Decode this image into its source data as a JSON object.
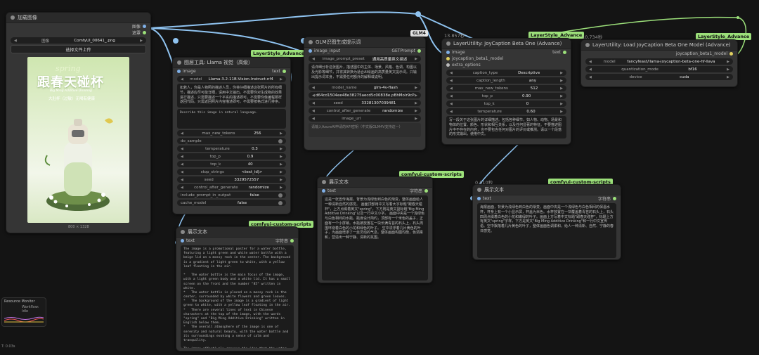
{
  "load_image": {
    "title": "加载图像",
    "outputs": [
      "图像",
      "遮罩"
    ],
    "image_label": "图像",
    "image_file": "ComfyUI_00641_.png",
    "upload_button": "选择文件上传",
    "image_size": "800 × 1328",
    "poster": {
      "spring": "spring",
      "title": "跟春天碰杯",
      "subtitle": "Big Ming Additive Drinking",
      "tagline": "大肚杯（过敏）无喝有健康"
    }
  },
  "llama": {
    "badge": "LayerStyle_Advance",
    "title": "图层工具: Llama 视觉（高级）",
    "input_image": "image",
    "output_text": "text",
    "model_label": "model",
    "model_value": "Llama-3.2-11B-Vision-Instruct-nf4",
    "system_prompt": "如若人，你是人物照的描述人员，你将仔细描述这张照片的所有细节，描述应尽可能详细，请用中文输出。不需要你对生成物的效果进行描述，只需要描述一个平实的描述即可。不需要你像编程那样返回代码。只需返回照片内容描述即可。不需要按格式进行排序。",
    "user_prompt": "Describe this image in natural language.",
    "widgets": [
      {
        "label": "max_new_tokens",
        "value": "256"
      },
      {
        "label": "do_sample",
        "value": ""
      },
      {
        "label": "temperature",
        "value": "0.3"
      },
      {
        "label": "top_p",
        "value": "0.9"
      },
      {
        "label": "top_k",
        "value": "40"
      },
      {
        "label": "stop_strings",
        "value": "<text_id|>"
      },
      {
        "label": "seed",
        "value": "3329572557"
      },
      {
        "label": "control_after_generate",
        "value": "randomize"
      },
      {
        "label": "include_prompt_in_output",
        "value": "false"
      },
      {
        "label": "cache_model",
        "value": "false"
      }
    ]
  },
  "glm": {
    "badge": "GLM4",
    "title": "GLM识图生成提示词",
    "input_image": "image_input",
    "output_text": "GETPrompt",
    "preset_label": "image_prompt_preset",
    "preset_value": "通用高质量英文描述",
    "prompt_text": "请详细分析这张图片，描述图中的主体、场景、风格、色调、构图以及光影等细节，并将其转换为适合AI绘画的高质量英文提示词。只输出提示词本身，不需要任何额外的解释或说明。",
    "widgets": [
      {
        "label": "model_name",
        "value": "glm-4v-flash"
      },
      {
        "label": "",
        "value": "d64cd1504ee48e38275aecd5c00838e.pBhMolr9cP"
      },
      {
        "label": "seed",
        "value": "33281307039481"
      },
      {
        "label": "control_after_generate",
        "value": "randomize"
      },
      {
        "label": "image_url",
        "value": ""
      }
    ],
    "footer": "请输入AzureAI申请的API密钥（中文版GLM4V支持这一）"
  },
  "joy_adv": {
    "timing": "13.857秒",
    "badge": "LayerStyle_Advance",
    "title": "LayerUtility: JoyCaption Beta One (Advance)",
    "inputs": [
      "image",
      "joycaption_beta1_model",
      "extra_options"
    ],
    "output_text": "text",
    "widgets": [
      {
        "label": "caption_type",
        "value": "Descriptive"
      },
      {
        "label": "caption_length",
        "value": "any"
      },
      {
        "label": "max_new_tokens",
        "value": "512"
      },
      {
        "label": "top_p",
        "value": "0.90"
      },
      {
        "label": "top_k",
        "value": "0"
      },
      {
        "label": "temperature",
        "value": "0.60"
      }
    ],
    "prompt_text": "写一段关于这张图片的详细描述。包括各种细节，如人物、动物、场景和物体的位置、颜色、形状和相互关系，以及任何显著的特征。不要描述图片中不存在的内容，也不要包含任何对图片的评价或推测。请以一个段落的形式输出，使用中文。"
  },
  "joy_load": {
    "timing": "10.734秒",
    "badge": "LayerStyle_Advance",
    "title": "LayerUtility: Load JoyCaption Beta One Model (Advance)",
    "output": "joycaption_beta1_model",
    "widgets": [
      {
        "label": "model",
        "value": "fancyfeast/llama-joycaption-beta-one-hf-llava"
      },
      {
        "label": "quantization_mode",
        "value": "bf16"
      },
      {
        "label": "device",
        "value": "cuda"
      }
    ]
  },
  "show_text_1": {
    "badge": "comfyui-custom-scripts",
    "title": "展示文本",
    "input": "text",
    "output": "字符串",
    "content": "The image is a promotional poster for a water bottle, featuring a light green and white water bottle with a beige lid on a mossy rock in the center. The background is a gradient of light green to white, with a yellow leaf floating in the air.\n\n*   The water bottle is the main focus of the image, with a light green body and a white lid. It has a small screen on the front and the number \"85\" written in white.\n*   The water bottle is placed on a mossy rock in the center, surrounded by white flowers and green leaves.\n*   The background of the image is a gradient of light green to white, with a yellow leaf floating in the air.\n*   There are several lines of text in Chinese characters at the top of the image, with the words \"spring\" and \"Big Ming Additive Drinking\" written in English below them.\n*   The overall atmosphere of the image is one of serenity and natural beauty, with the water bottle and its surroundings evoking a sense of calm and tranquility.\n\nThe image effectively conveys the idea that the water bottle is a refreshing and natural choice, and the use of a mossy rock and white flowers adds a touch of elegance and sophistication."
  },
  "show_text_2": {
    "badge": "comfyui-custom-scripts",
    "title": "展示文本",
    "input": "text",
    "output": "字符串",
    "content": "这是一张宣传海报，背景为浅绿色到白色的渐变，整体画面给人一种清新自然的感觉。\n\n画面顶部用中文写着大字标题\"跟春天碰杯\"，上方点缀着英文\"spring\"，下方则是英文副标题\"Big Ming Additive Drinking\"以及一行中文小字。\n\n画面中央是一个浅绿色与白色相间的水瓶，瓶身设计简约，顶部有一个米色的盖子，正面有一个小屏幕。水瓶被放置在一块长满青苔的石头上，石头周围环绕着白色的小花和绿色的叶子。\n\n空中漂浮着几片黄色的叶子，为画面增添了一丝灵动的气息。整体画面构图均衡，色调柔和，营造出一种宁静、清新的氛围。"
  },
  "show_text_3": {
    "timing": "0.010秒",
    "badge": "comfyui-custom-scripts",
    "title": "展示文本",
    "input": "text",
    "output": "字符串",
    "content": "海报画面，背景为浅绿色到白色的渐变。画面中央是一个浅绿色与白色相间的保温水杯，杯身上有一个小显示屏，杯盖为米色。水杯放置在一块覆盖着青苔的石头上，石头四周点缀着白色的小花和嫩绿的叶子。画面上方写着中文标题\"跟春天碰杯\"，标题上方有英文\"spring\"字样，下方是英文\"Big Ming Additive Drinking\"和一行中文宣传语。空中飘落着几片黄色的叶子，整体画面色调柔和，给人一种清新、自然、宁静的春日感觉。"
  },
  "resource_monitor": {
    "title": "Resource Monitor",
    "status": "Workflow: Idle"
  },
  "bottom_left": "T: 0.03s"
}
